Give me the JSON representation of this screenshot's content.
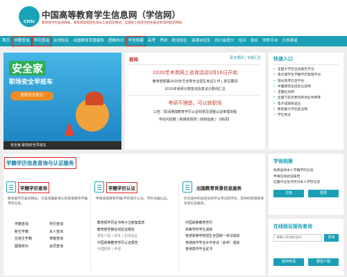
{
  "header": {
    "logo_text": "CHSI",
    "title": "中国高等教育学生信息网（学信网）",
    "subtitle": "教育部学历查询网站、教育部高校招生阳光工程指定网站、全国硕士研究生招生报名和调剂指定网站"
  },
  "nav": [
    "首页",
    "学籍查询",
    "学历查询",
    "在线验证",
    "出国教育背景服务",
    "图像校对",
    "学信档案",
    "高考",
    "考研",
    "政法招生",
    "港澳台招生",
    "四六级查分",
    "征兵",
    "就业",
    "学职平台",
    "日本频道"
  ],
  "hero": {
    "badge": "安全家",
    "slogan": "职场安全早班车",
    "button": "获取安全知识",
    "footer": "安全家-职场安全早班车"
  },
  "news": {
    "title": "要闻",
    "links": "更多要闻 | 专题汇总",
    "headline": "2020艺术类网上咨询活动3月16日开始",
    "line1": "教育部部署2020年艺术类专业招生考试工作 | 意见要闻",
    "line2": "2020年考研分数查询及复试分数线汇总",
    "headline2": "考研不理想，可以转职场",
    "line3": "公告：取消港澳教育学历认证收费及调整认证审理流程",
    "line4": "学信问招聘 | 新媒体矩阵 | 转职指南 | 【新闻】"
  },
  "quick": {
    "title": "快速入口",
    "items": [
      "全国大学生征兵报名平台",
      "来华留学生学籍学历管理平台",
      "阳光高考信息平台",
      "中国研究生招生信息网",
      "全国征兵网",
      "全国万名优秀创新创业导师库",
      "电子成绩单验证",
      "教育部大学生就业网",
      "学信就业"
    ]
  },
  "services": {
    "title": "学籍学历信息查询与认证服务",
    "cols": [
      {
        "title": "学籍学历查询",
        "desc": "教育部学历查询网站，可查询国家承认的高等教育学籍学历信息。",
        "grid": [
          "学籍查询",
          "学历查询",
          "新生学籍",
          "本人查询",
          "在校生学籍",
          "零散查询",
          "图像校对",
          "会员查询"
        ]
      },
      {
        "title": "学籍学历认证",
        "desc": "申请高等教育学籍/学历电子认证、学历书面认证。",
        "lines": [
          "教育部学历证书电子注册备案表",
          "教育部学籍在线验证报告",
          "报告介绍 | 样本 | 在线验证",
          "",
          "中国高等教育学历认证报告",
          "代理机构 | 申请"
        ]
      },
      {
        "title": "出国教育背景信息服务",
        "desc": "针对高中阶段招生和学业考试的学生，提供的高等教育背景信息服务。",
        "lines": [
          "中国高等教育学历",
          "高等学校学生成绩",
          "普通高等学校招生全国统一考试成绩",
          "普通高中学业水平考试（会考）成绩",
          "普通高中毕业证书"
        ]
      }
    ]
  },
  "archive": {
    "title": "学信档案",
    "lines": [
      "免费查询本人学籍学历信息",
      "申请在线验证报告",
      "应届毕业生可校对本人学历信息"
    ],
    "register": "注册",
    "login": "登录"
  },
  "verify": {
    "title": "在线验证报告查询",
    "placeholder": "请输入在线验证码",
    "query": "查询",
    "apply": "如何申请",
    "help": "报告介绍"
  }
}
